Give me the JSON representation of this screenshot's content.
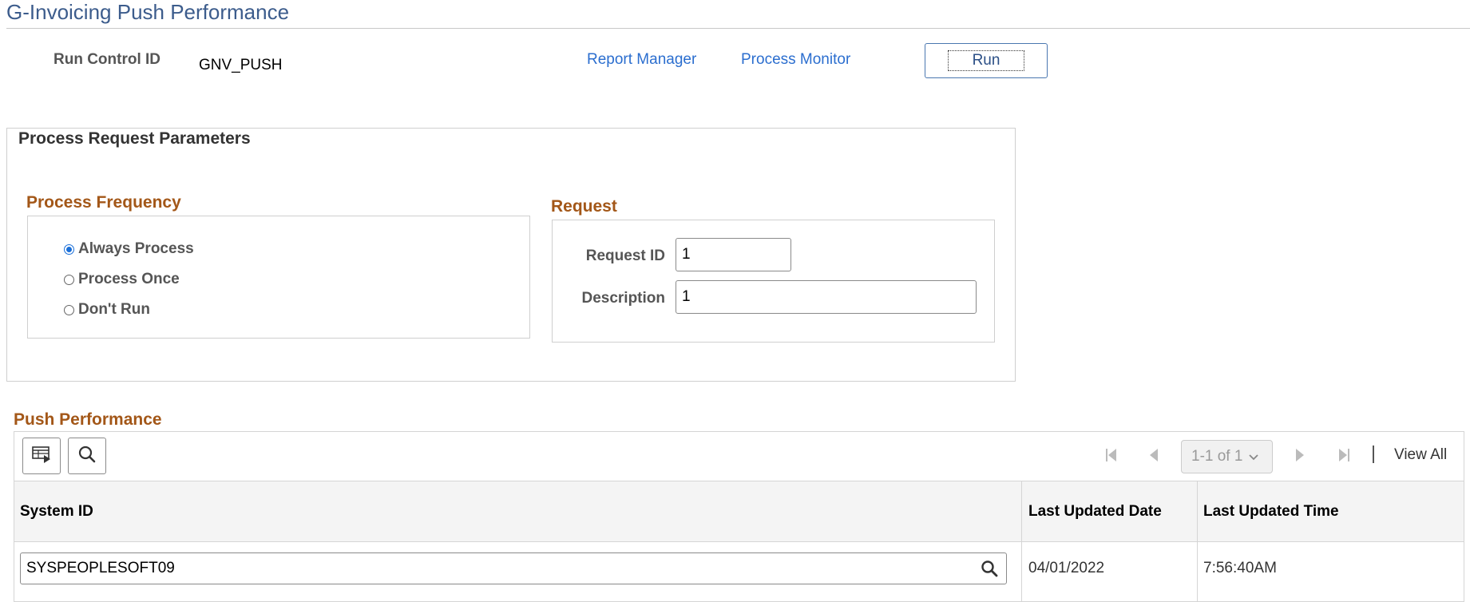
{
  "page": {
    "title": "G-Invoicing Push Performance"
  },
  "run_control": {
    "label": "Run Control ID",
    "value": "GNV_PUSH",
    "report_manager": "Report Manager",
    "process_monitor": "Process Monitor",
    "run_label": "Run"
  },
  "params": {
    "title": "Process Request Parameters",
    "frequency": {
      "title": "Process Frequency",
      "options": [
        {
          "label": "Always Process",
          "checked": true
        },
        {
          "label": "Process Once",
          "checked": false
        },
        {
          "label": "Don't Run",
          "checked": false
        }
      ]
    },
    "request": {
      "title": "Request",
      "request_id_label": "Request ID",
      "request_id_value": "1",
      "description_label": "Description",
      "description_value": "1"
    }
  },
  "grid": {
    "title": "Push Performance",
    "pager_text": "1-1 of 1",
    "view_all": "View All",
    "columns": [
      "System ID",
      "Last Updated Date",
      "Last Updated Time"
    ],
    "rows": [
      {
        "system_id": "SYSPEOPLESOFT09",
        "date": "04/01/2022",
        "time": "7:56:40AM"
      }
    ]
  },
  "icons": {
    "personalize": "grid-personalize-icon",
    "find": "search-icon",
    "first": "first-page-icon",
    "prev": "previous-page-icon",
    "next": "next-page-icon",
    "last": "last-page-icon",
    "lookup": "lookup-search-icon"
  },
  "colors": {
    "title": "#3c5c8c",
    "link": "#2b6ecf",
    "section": "#a35718",
    "radio_checked": "#1a6fd8"
  }
}
